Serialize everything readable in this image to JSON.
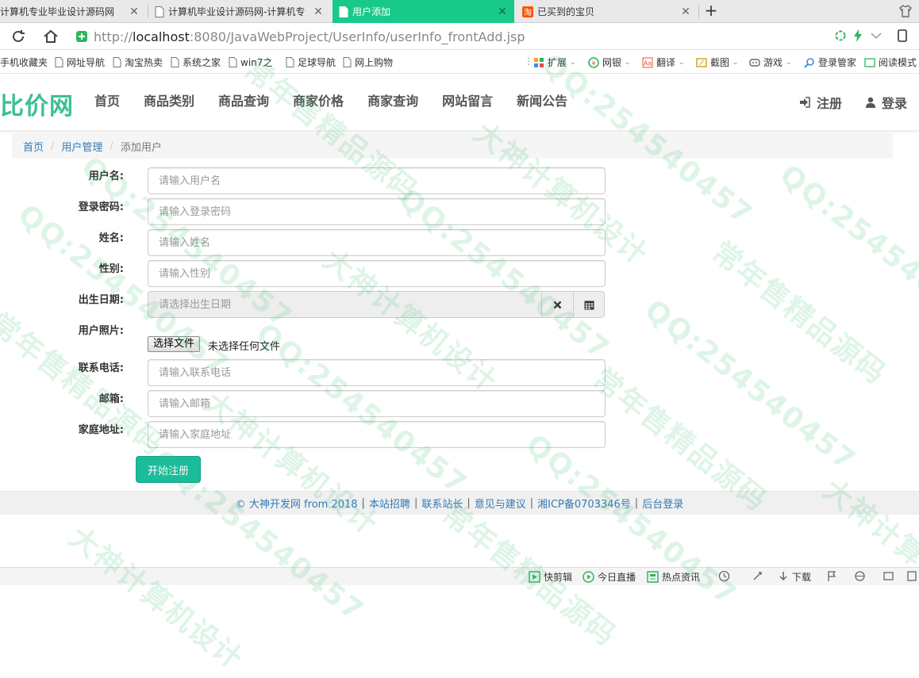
{
  "browser": {
    "tabs": [
      {
        "label": "计算机专业毕业设计源码网",
        "active": false
      },
      {
        "label": "计算机毕业设计源码网-计算机专",
        "active": false
      },
      {
        "label": "用户添加",
        "active": true
      },
      {
        "label": "已买到的宝贝",
        "active": false
      }
    ],
    "new_tab_label": "+",
    "url_prefix": "http://",
    "url_host": "localhost",
    "url_rest": ":8080/JavaWebProject/UserInfo/userInfo_frontAdd.jsp",
    "bookmarks": [
      "手机收藏夹",
      "网址导航",
      "淘宝热卖",
      "系统之家",
      "win7之",
      "足球导航",
      "网上购物"
    ],
    "toolbar_right": [
      "扩展",
      "网银",
      "翻译",
      "截图",
      "游戏",
      "登录管家",
      "阅读模式"
    ]
  },
  "site": {
    "logo": "比价网",
    "nav": [
      "首页",
      "商品类别",
      "商品查询",
      "商家价格",
      "商家查询",
      "网站留言",
      "新闻公告"
    ],
    "register_label": "注册",
    "login_label": "登录"
  },
  "breadcrumb": {
    "home": "首页",
    "section": "用户管理",
    "current": "添加用户",
    "separator": "/"
  },
  "form": {
    "username": {
      "label": "用户名:",
      "placeholder": "请输入用户名"
    },
    "password": {
      "label": "登录密码:",
      "placeholder": "请输入登录密码"
    },
    "name": {
      "label": "姓名:",
      "placeholder": "请输入姓名"
    },
    "gender": {
      "label": "性别:",
      "placeholder": "请输入性别"
    },
    "birthday": {
      "label": "出生日期:",
      "placeholder": "请选择出生日期"
    },
    "photo": {
      "label": "用户照片:",
      "button": "选择文件",
      "status": "未选择任何文件"
    },
    "phone": {
      "label": "联系电话:",
      "placeholder": "请输入联系电话"
    },
    "email": {
      "label": "邮箱:",
      "placeholder": "请输入邮箱"
    },
    "address": {
      "label": "家庭地址:",
      "placeholder": "请输入家庭地址"
    },
    "submit": "开始注册"
  },
  "footer": {
    "copyright": "© 大神开发网 from 2018",
    "links": [
      "本站招聘",
      "联系站长",
      "意见与建议",
      "湘ICP备0703346号",
      "后台登录"
    ],
    "separator": "|"
  },
  "statusbar": [
    "快剪辑",
    "今日直播",
    "热点资讯",
    "下载"
  ],
  "watermark": {
    "texts": [
      "QQ:254540457",
      "大神计算机设计",
      "常年售精品源码"
    ]
  },
  "colors": {
    "brand": "#3cbf95",
    "active_tab": "#19c98a",
    "primary_button": "#1abc9c",
    "link": "#337ab7"
  }
}
